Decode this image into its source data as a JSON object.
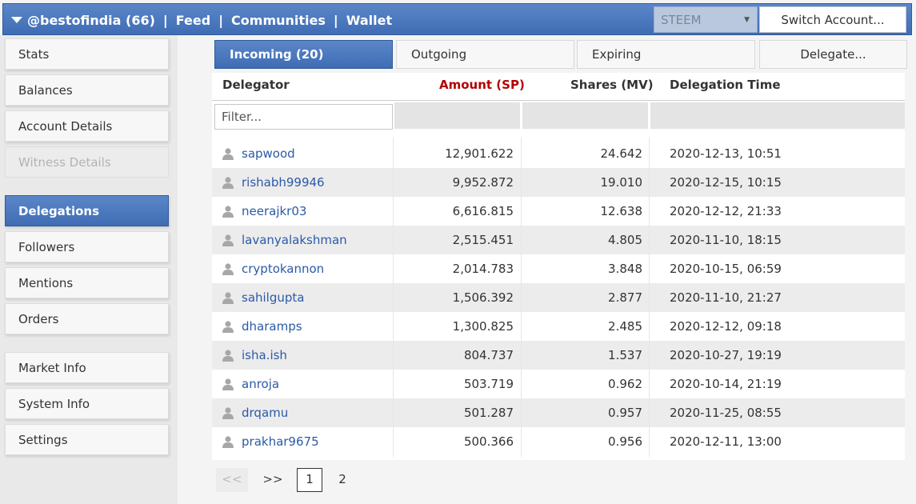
{
  "header": {
    "account": "@bestofindia (66)",
    "nav": [
      "Feed",
      "Communities",
      "Wallet"
    ],
    "chain_select": "STEEM",
    "switch_account": "Switch Account..."
  },
  "sidebar": {
    "items": [
      {
        "label": "Stats"
      },
      {
        "label": "Balances"
      },
      {
        "label": "Account Details"
      },
      {
        "label": "Witness Details",
        "disabled": true
      },
      {
        "label": "Delegations",
        "active": true
      },
      {
        "label": "Followers"
      },
      {
        "label": "Mentions"
      },
      {
        "label": "Orders"
      },
      {
        "label": "Market Info"
      },
      {
        "label": "System Info"
      },
      {
        "label": "Settings"
      }
    ]
  },
  "tabs": [
    "Incoming (20)",
    "Outgoing",
    "Expiring",
    "Delegate..."
  ],
  "table": {
    "columns": [
      "Delegator",
      "Amount (SP)",
      "Shares (MV)",
      "Delegation Time"
    ],
    "filter_placeholder": "Filter...",
    "rows": [
      [
        "sapwood",
        "12,901.622",
        "24.642",
        "2020-12-13, 10:51"
      ],
      [
        "rishabh99946",
        "9,952.872",
        "19.010",
        "2020-12-15, 10:15"
      ],
      [
        "neerajkr03",
        "6,616.815",
        "12.638",
        "2020-12-12, 21:33"
      ],
      [
        "lavanyalakshman",
        "2,515.451",
        "4.805",
        "2020-11-10, 18:15"
      ],
      [
        "cryptokannon",
        "2,014.783",
        "3.848",
        "2020-10-15, 06:59"
      ],
      [
        "sahilgupta",
        "1,506.392",
        "2.877",
        "2020-11-10, 21:27"
      ],
      [
        "dharamps",
        "1,300.825",
        "2.485",
        "2020-12-12, 09:18"
      ],
      [
        "isha.ish",
        "804.737",
        "1.537",
        "2020-10-27, 19:19"
      ],
      [
        "anroja",
        "503.719",
        "0.962",
        "2020-10-14, 21:19"
      ],
      [
        "drqamu",
        "501.287",
        "0.957",
        "2020-11-25, 08:55"
      ],
      [
        "prakhar9675",
        "500.366",
        "0.956",
        "2020-12-11, 13:00"
      ]
    ]
  },
  "pagination": {
    "prev": "<<",
    "next": ">>",
    "pages": [
      "1",
      "2"
    ],
    "current": "1"
  }
}
